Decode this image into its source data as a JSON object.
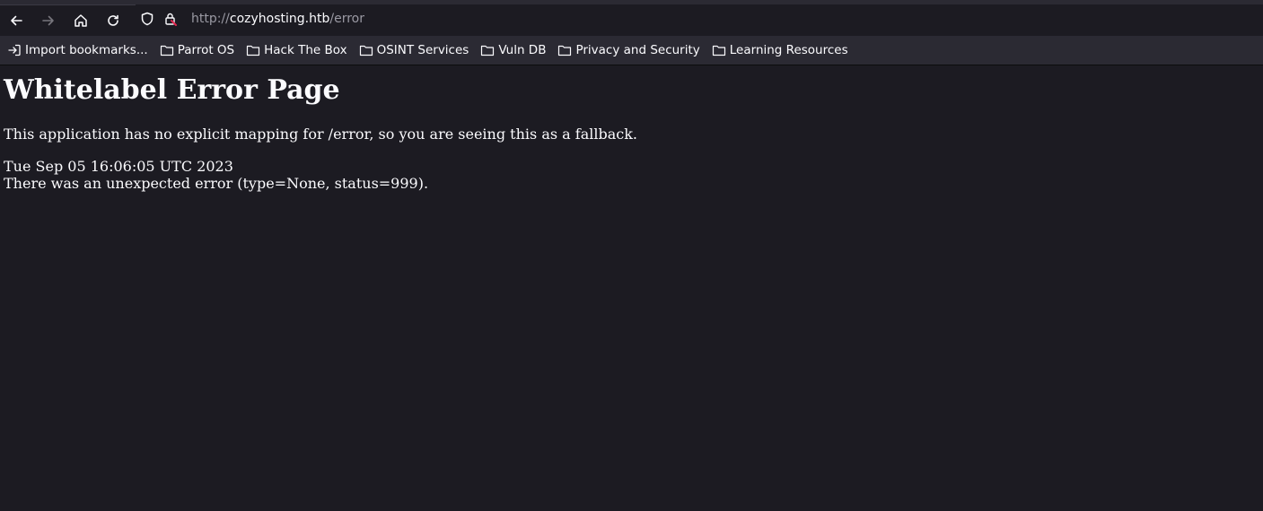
{
  "browser": {
    "url_scheme": "http://",
    "url_host": "cozyhosting.htb",
    "url_path": "/error"
  },
  "bookmarks": [
    {
      "label": "Import bookmarks...",
      "icon": "import-icon"
    },
    {
      "label": "Parrot OS",
      "icon": "folder-icon"
    },
    {
      "label": "Hack The Box",
      "icon": "folder-icon"
    },
    {
      "label": "OSINT Services",
      "icon": "folder-icon"
    },
    {
      "label": "Vuln DB",
      "icon": "folder-icon"
    },
    {
      "label": "Privacy and Security",
      "icon": "folder-icon"
    },
    {
      "label": "Learning Resources",
      "icon": "folder-icon"
    }
  ],
  "page": {
    "title": "Whitelabel Error Page",
    "message": "This application has no explicit mapping for /error, so you are seeing this as a fallback.",
    "timestamp": "Tue Sep 05 16:06:05 UTC 2023",
    "error_detail": "There was an unexpected error (type=None, status=999)."
  },
  "colors": {
    "background": "#1c1b22",
    "toolbar": "#2b2a33",
    "text": "#fbfbfe",
    "url_dim": "#9a99a3",
    "lock_warning": "#e22850"
  }
}
